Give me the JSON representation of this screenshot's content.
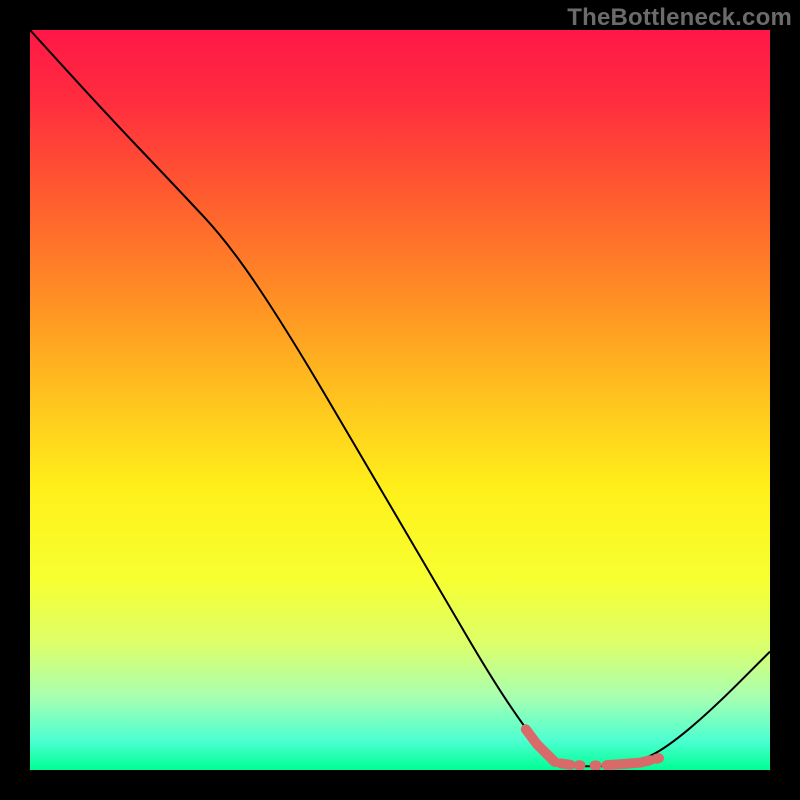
{
  "watermark": "TheBottleneck.com",
  "chart_data": {
    "type": "line",
    "title": "",
    "xlabel": "",
    "ylabel": "",
    "xlim": [
      0,
      100
    ],
    "ylim": [
      0,
      100
    ],
    "grid": false,
    "series": [
      {
        "name": "gradient-background",
        "kind": "gradient",
        "stops": [
          {
            "offset": 0.0,
            "color": "#ff1747"
          },
          {
            "offset": 0.1,
            "color": "#ff2e3e"
          },
          {
            "offset": 0.22,
            "color": "#ff5a2f"
          },
          {
            "offset": 0.35,
            "color": "#ff8a25"
          },
          {
            "offset": 0.5,
            "color": "#ffc41e"
          },
          {
            "offset": 0.62,
            "color": "#fff01a"
          },
          {
            "offset": 0.74,
            "color": "#f7ff30"
          },
          {
            "offset": 0.83,
            "color": "#dcff6a"
          },
          {
            "offset": 0.9,
            "color": "#a9ffb0"
          },
          {
            "offset": 0.96,
            "color": "#4dffd1"
          },
          {
            "offset": 1.0,
            "color": "#00ff95"
          }
        ]
      },
      {
        "name": "bottleneck-curve",
        "kind": "line",
        "color": "#000000",
        "width": 2,
        "data": [
          {
            "x": 0.0,
            "y": 100.0
          },
          {
            "x": 10.0,
            "y": 89.0
          },
          {
            "x": 20.0,
            "y": 78.5
          },
          {
            "x": 27.0,
            "y": 71.0
          },
          {
            "x": 35.0,
            "y": 59.0
          },
          {
            "x": 45.0,
            "y": 42.0
          },
          {
            "x": 55.0,
            "y": 25.0
          },
          {
            "x": 62.0,
            "y": 13.0
          },
          {
            "x": 67.0,
            "y": 5.5
          },
          {
            "x": 70.0,
            "y": 2.0
          },
          {
            "x": 73.0,
            "y": 0.5
          },
          {
            "x": 78.0,
            "y": 0.5
          },
          {
            "x": 82.0,
            "y": 1.0
          },
          {
            "x": 86.0,
            "y": 3.0
          },
          {
            "x": 92.0,
            "y": 8.0
          },
          {
            "x": 100.0,
            "y": 16.0
          }
        ]
      },
      {
        "name": "optimal-band-marker",
        "kind": "marker",
        "color": "#d96a6a",
        "data": [
          {
            "x": 67.0,
            "y": 5.5
          },
          {
            "x": 68.5,
            "y": 3.5
          },
          {
            "x": 70.0,
            "y": 2.0
          },
          {
            "x": 71.0,
            "y": 1.0
          },
          {
            "x": 73.0,
            "y": 0.7
          },
          {
            "x": 75.0,
            "y": 0.6
          },
          {
            "x": 77.0,
            "y": 0.6
          },
          {
            "x": 80.0,
            "y": 0.8
          },
          {
            "x": 82.5,
            "y": 1.0
          },
          {
            "x": 85.0,
            "y": 1.6
          }
        ]
      }
    ]
  }
}
